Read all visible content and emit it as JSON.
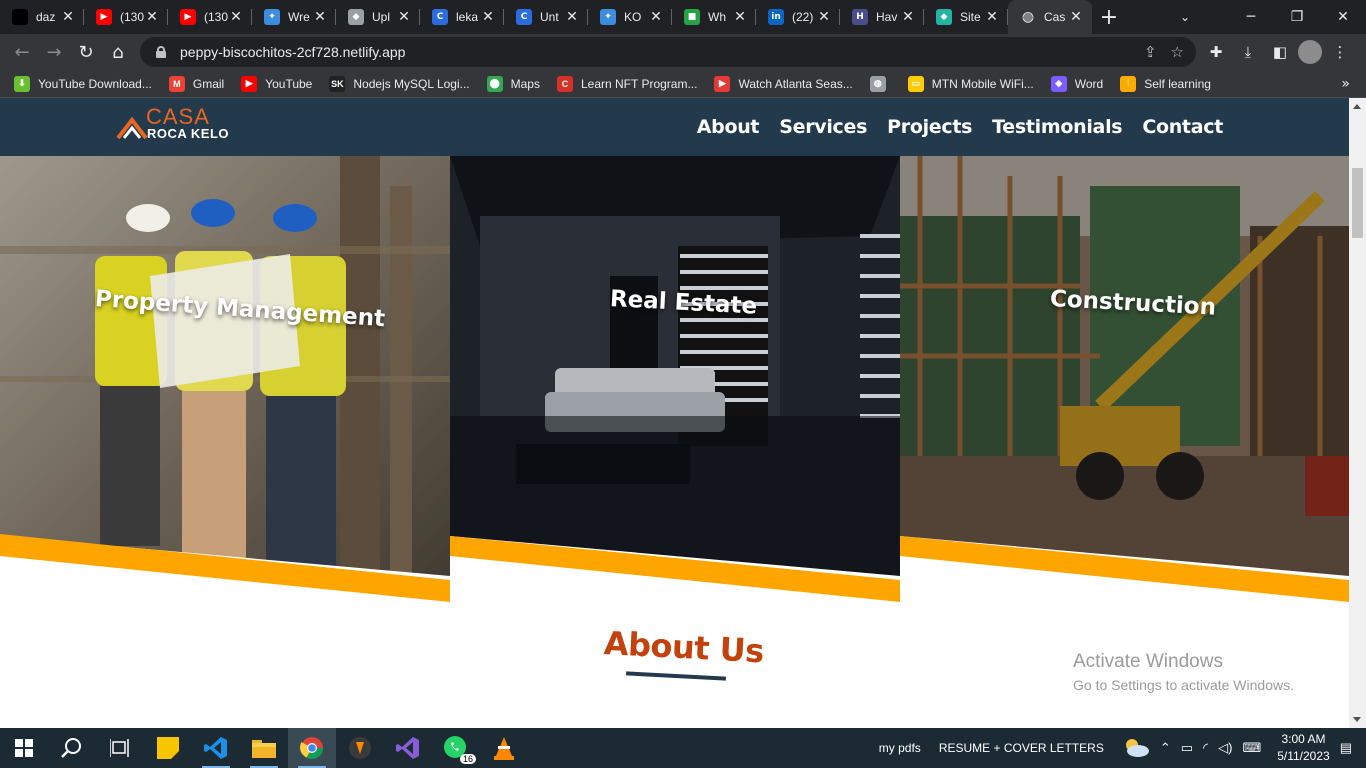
{
  "browser": {
    "tabs": [
      {
        "title": "daz",
        "favicon_color": "#000000",
        "favicon_glyph": ""
      },
      {
        "title": "(130",
        "favicon_color": "#ff0000",
        "favicon_glyph": "▶"
      },
      {
        "title": "(130",
        "favicon_color": "#ff0000",
        "favicon_glyph": "▶"
      },
      {
        "title": "Wre",
        "favicon_color": "#3c8dde",
        "favicon_glyph": "✦"
      },
      {
        "title": "Upl",
        "favicon_color": "#9aa0a6",
        "favicon_glyph": "◆"
      },
      {
        "title": "leka",
        "favicon_color": "#2d6cdf",
        "favicon_glyph": "C"
      },
      {
        "title": "Unt",
        "favicon_color": "#2d6cdf",
        "favicon_glyph": "C"
      },
      {
        "title": "KO",
        "favicon_color": "#3c8dde",
        "favicon_glyph": "✦"
      },
      {
        "title": "Wh",
        "favicon_color": "#25a244",
        "favicon_glyph": "■"
      },
      {
        "title": "(22)",
        "favicon_color": "#0a66c2",
        "favicon_glyph": "in"
      },
      {
        "title": "Hav",
        "favicon_color": "#4a4e8a",
        "favicon_glyph": "H"
      },
      {
        "title": "Site",
        "favicon_color": "#23b3a4",
        "favicon_glyph": "◆"
      },
      {
        "title": "Cas",
        "favicon_color": "#e8eaed",
        "favicon_glyph": "◍",
        "active": true
      }
    ],
    "new_tab_glyph": "+",
    "url": "peppy-biscochitos-2cf728.netlify.app",
    "bookmarks": [
      {
        "label": "YouTube Download...",
        "color": "#6abf2e",
        "glyph": "⬇"
      },
      {
        "label": "Gmail",
        "color": "#ea4335",
        "glyph": "M"
      },
      {
        "label": "YouTube",
        "color": "#ff0000",
        "glyph": "▶"
      },
      {
        "label": "Nodejs MySQL Logi...",
        "color": "#222222",
        "glyph": "SK"
      },
      {
        "label": "Maps",
        "color": "#34a853",
        "glyph": "⬤"
      },
      {
        "label": "Learn NFT Program...",
        "color": "#d93025",
        "glyph": "C"
      },
      {
        "label": "Watch Atlanta Seas...",
        "color": "#e53935",
        "glyph": "▶"
      },
      {
        "label": "",
        "color": "#9aa0a6",
        "glyph": "◍"
      },
      {
        "label": "MTN Mobile WiFi...",
        "color": "#ffcb05",
        "glyph": "▭"
      },
      {
        "label": "Word",
        "color": "#7b5cff",
        "glyph": "◆"
      },
      {
        "label": "Self learning",
        "color": "#f9ab00",
        "glyph": "⫶"
      }
    ],
    "bookmarks_more_glyph": "»"
  },
  "site": {
    "logo": {
      "line1": "CASA",
      "line2": "ROCA KELO"
    },
    "nav": [
      "About",
      "Services",
      "Projects",
      "Testimonials",
      "Contact"
    ],
    "services": [
      {
        "label": "Property Management"
      },
      {
        "label": "Real Estate"
      },
      {
        "label": "Construction"
      }
    ],
    "about_title": "About Us",
    "accent_color": "#ffa500",
    "nav_color": "#233a4d",
    "title_color": "#c2410c"
  },
  "watermark": {
    "line1": "Activate Windows",
    "line2": "Go to Settings to activate Windows."
  },
  "taskbar": {
    "items": [
      "windows-start",
      "search",
      "task-view",
      "sticky-notes",
      "vscode",
      "file-explorer",
      "chrome",
      "fl-studio",
      "visual-studio",
      "whatsapp",
      "vlc"
    ],
    "whatsapp_badge": "16",
    "label_pdfs": "my pdfs",
    "label_resume": "RESUME + COVER LETTERS",
    "time": "3:00 AM",
    "date": "5/11/2023"
  }
}
